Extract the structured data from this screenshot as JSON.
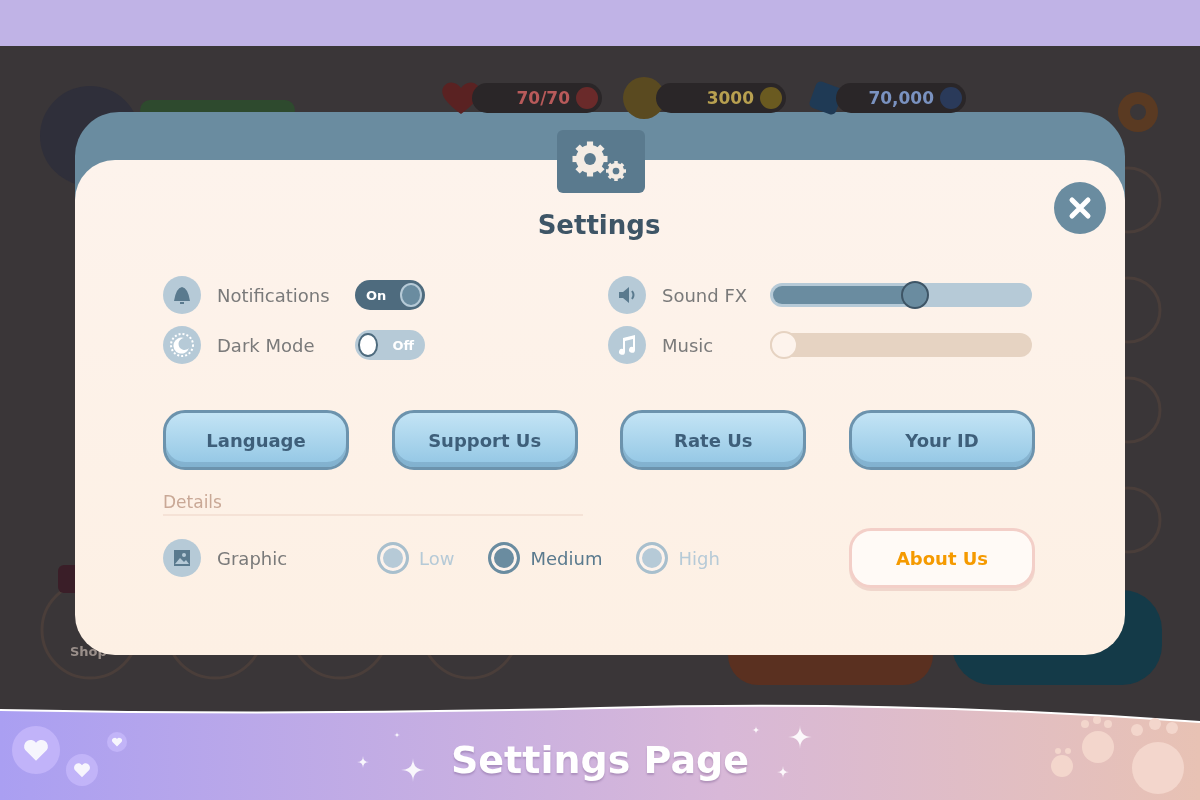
{
  "hud": {
    "lives": "70/70",
    "coins": "3000",
    "gems": "70,000"
  },
  "background_buttons": [
    {
      "label": "Shop"
    }
  ],
  "dialog": {
    "title": "Settings",
    "toggles": [
      {
        "label": "Notifications",
        "kind": "bell",
        "on": true,
        "text": "On"
      },
      {
        "label": "Dark Mode",
        "kind": "moon",
        "on": false,
        "text": "Off"
      }
    ],
    "sliders": [
      {
        "label": "Sound FX",
        "kind": "speaker",
        "level": 0.56,
        "color": "#b6cad7"
      },
      {
        "label": "Music",
        "kind": "note",
        "level": 0,
        "color": "#e6d3c2"
      }
    ],
    "buttons": [
      "Language",
      "Support Us",
      "Rate Us",
      "Your ID"
    ],
    "details_label": "Details",
    "graphic": {
      "label": "Graphic",
      "options": [
        {
          "label": "Low",
          "selected": false
        },
        {
          "label": "Medium",
          "selected": true
        },
        {
          "label": "High",
          "selected": false
        }
      ]
    },
    "about_button": "About Us"
  },
  "banner": {
    "title": "Settings Page"
  }
}
